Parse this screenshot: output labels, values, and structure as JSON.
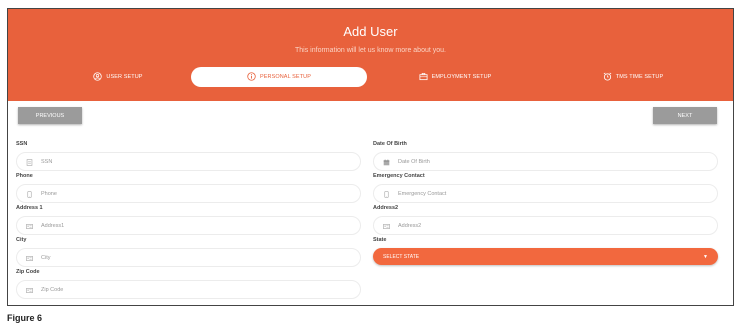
{
  "header": {
    "title": "Add User",
    "subtitle": "This information will let us know more about you."
  },
  "tabs": [
    {
      "label": "USER SETUP",
      "icon": "user-circle-icon",
      "active": false
    },
    {
      "label": "PERSONAL SETUP",
      "icon": "info-circle-icon",
      "active": true
    },
    {
      "label": "EMPLOYMENT SETUP",
      "icon": "briefcase-icon",
      "active": false
    },
    {
      "label": "TMS TIME SETUP",
      "icon": "alarm-clock-icon",
      "active": false
    }
  ],
  "nav": {
    "previous_label": "PREVIOUS",
    "next_label": "NEXT"
  },
  "form": {
    "left": [
      {
        "label": "SSN",
        "placeholder": "SSN",
        "icon": "id-card-icon"
      },
      {
        "label": "Phone",
        "placeholder": "Phone",
        "icon": "phone-icon"
      },
      {
        "label": "Address 1",
        "placeholder": "Address1",
        "icon": "address-card-icon"
      },
      {
        "label": "City",
        "placeholder": "City",
        "icon": "address-card-icon"
      },
      {
        "label": "Zip Code",
        "placeholder": "Zip Code",
        "icon": "address-card-icon"
      }
    ],
    "right": [
      {
        "label": "Date Of Birth",
        "placeholder": "Date Of Birth",
        "icon": "calendar-icon"
      },
      {
        "label": "Emergency Contact",
        "placeholder": "Emergency Contact",
        "icon": "phone-icon"
      },
      {
        "label": "Address2",
        "placeholder": "Address2",
        "icon": "address-card-icon"
      }
    ],
    "state": {
      "label": "State",
      "selected": "SELECT STATE"
    }
  },
  "caption": "Figure 6",
  "colors": {
    "header_bg": "#e8613c",
    "select_bg": "#f2683e",
    "button_bg": "#9b9b9b"
  }
}
